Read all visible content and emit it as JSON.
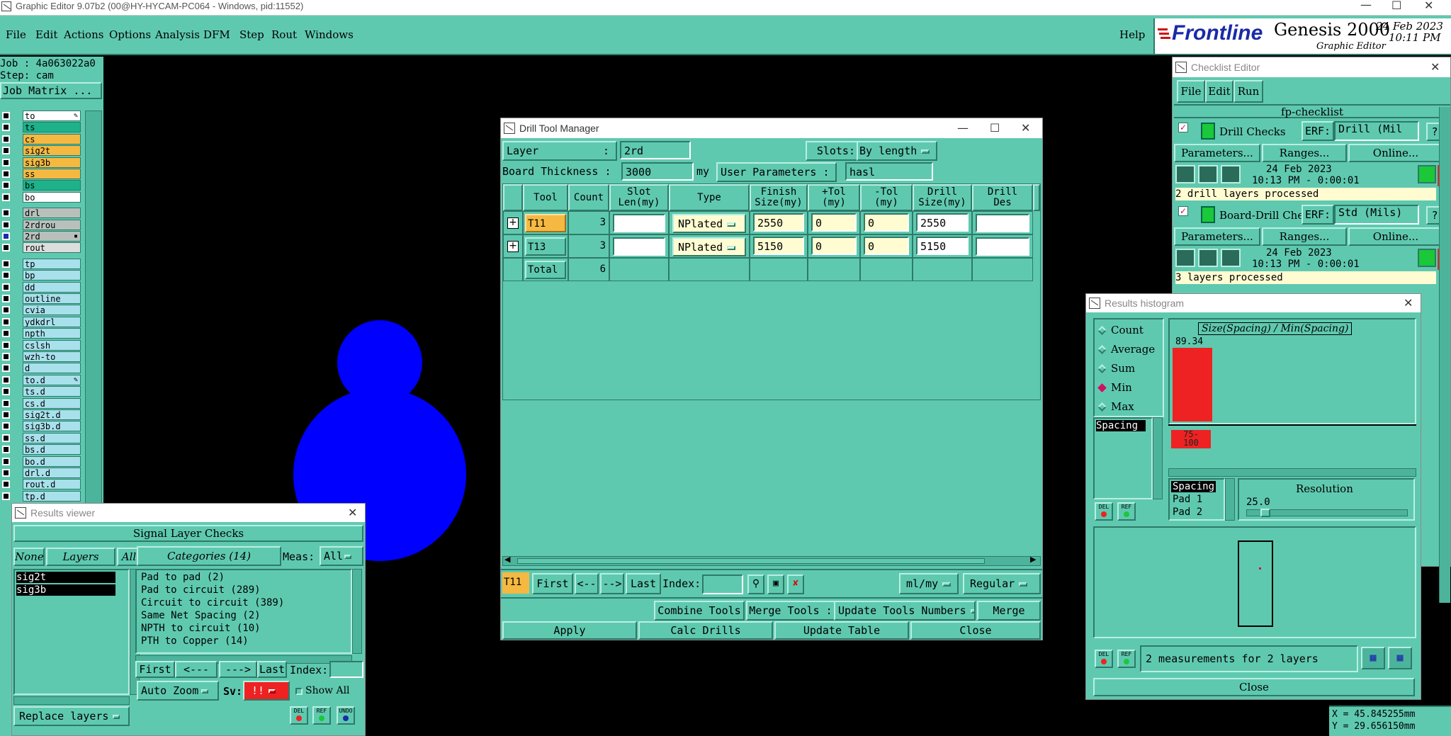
{
  "app": {
    "title_bar": "Graphic Editor 9.07b2 (00@HY-HYCAM-PC064 - Windows, pid:11552)",
    "menu": [
      "File",
      "Edit",
      "Actions",
      "Options",
      "Analysis",
      "DFM",
      "Step",
      "Rout",
      "Windows"
    ],
    "help": "Help",
    "brand": "Frontline",
    "product": "Genesis 2000",
    "subtitle": "Graphic Editor",
    "date": "24 Feb 2023",
    "time": "10:11 PM"
  },
  "left_panel": {
    "job": "Job : 4a063022a0",
    "step": "Step: cam",
    "job_matrix": "Job Matrix ...",
    "layers": [
      {
        "name": "to",
        "bg": "#ffffff",
        "mark": "✎"
      },
      {
        "name": "ts",
        "bg": "#1db28a",
        "mark": ""
      },
      {
        "name": "cs",
        "bg": "#f5b942",
        "mark": ""
      },
      {
        "name": "sig2t",
        "bg": "#f5b942",
        "mark": ""
      },
      {
        "name": "sig3b",
        "bg": "#f5b942",
        "mark": ""
      },
      {
        "name": "ss",
        "bg": "#f5b942",
        "mark": ""
      },
      {
        "name": "bs",
        "bg": "#1db28a",
        "mark": ""
      },
      {
        "name": "bo",
        "bg": "#ffffff",
        "mark": ""
      },
      {
        "name": "drl",
        "bg": "#b8c0bc",
        "mark": ""
      },
      {
        "name": "2rdrou",
        "bg": "#b8c0bc",
        "mark": ""
      },
      {
        "name": "2rd",
        "bg": "#b8c0bc",
        "mark": "▪"
      },
      {
        "name": "rout",
        "bg": "#dddddd",
        "mark": ""
      },
      {
        "name": "tp",
        "bg": "#a8e0ec",
        "mark": ""
      },
      {
        "name": "bp",
        "bg": "#a8e0ec",
        "mark": ""
      },
      {
        "name": "dd",
        "bg": "#a8e0ec",
        "mark": ""
      },
      {
        "name": "outline",
        "bg": "#a8e0ec",
        "mark": ""
      },
      {
        "name": "cvia",
        "bg": "#a8e0ec",
        "mark": ""
      },
      {
        "name": "ydkdrl",
        "bg": "#a8e0ec",
        "mark": ""
      },
      {
        "name": "npth",
        "bg": "#a8e0ec",
        "mark": ""
      },
      {
        "name": "cslsh",
        "bg": "#a8e0ec",
        "mark": ""
      },
      {
        "name": "wzh-to",
        "bg": "#a8e0ec",
        "mark": ""
      },
      {
        "name": "d",
        "bg": "#a8e0ec",
        "mark": ""
      },
      {
        "name": "to.d",
        "bg": "#a8e0ec",
        "mark": "✎"
      },
      {
        "name": "ts.d",
        "bg": "#a8e0ec",
        "mark": ""
      },
      {
        "name": "cs.d",
        "bg": "#a8e0ec",
        "mark": ""
      },
      {
        "name": "sig2t.d",
        "bg": "#a8e0ec",
        "mark": ""
      },
      {
        "name": "sig3b.d",
        "bg": "#a8e0ec",
        "mark": ""
      },
      {
        "name": "ss.d",
        "bg": "#a8e0ec",
        "mark": ""
      },
      {
        "name": "bs.d",
        "bg": "#a8e0ec",
        "mark": ""
      },
      {
        "name": "bo.d",
        "bg": "#a8e0ec",
        "mark": ""
      },
      {
        "name": "drl.d",
        "bg": "#a8e0ec",
        "mark": ""
      },
      {
        "name": "rout.d",
        "bg": "#a8e0ec",
        "mark": ""
      },
      {
        "name": "tp.d",
        "bg": "#a8e0ec",
        "mark": ""
      }
    ]
  },
  "drill_tool_manager": {
    "title": "Drill Tool Manager",
    "layer_label": "Layer",
    "layer_value": "2rd",
    "slots_label": "Slots:",
    "slots_value": "By length",
    "board_thickness_label": "Board Thickness :",
    "board_thickness_value": "3000",
    "board_thickness_unit": "my",
    "user_parameters_label": "User Parameters :",
    "user_parameters_value": "hasl",
    "columns": [
      "Tool",
      "Count",
      "Slot\nLen(my)",
      "Type",
      "Finish\nSize(my)",
      "+Tol\n(my)",
      "-Tol\n(my)",
      "Drill\nSize(my)",
      "Drill\nDes"
    ],
    "rows": [
      {
        "tool": "T11",
        "count": "3",
        "slot_len": "",
        "type": "NPlated",
        "finish": "2550",
        "ptol": "0",
        "mtol": "0",
        "drill": "2550",
        "des": ""
      },
      {
        "tool": "T13",
        "count": "3",
        "slot_len": "",
        "type": "NPlated",
        "finish": "5150",
        "ptol": "0",
        "mtol": "0",
        "drill": "5150",
        "des": ""
      }
    ],
    "total_label": "Total",
    "total_count": "6",
    "current_tool": "T11",
    "first": "First",
    "prev": "<--",
    "next": "-->",
    "last": "Last",
    "index_label": "Index:",
    "units": "ml/my",
    "mode": "Regular",
    "combine_tools": "Combine Tools",
    "merge_tools": "Merge Tools :",
    "update_tools_numbers": "Update Tools Numbers",
    "merge": "Merge",
    "apply": "Apply",
    "calc_drills": "Calc Drills",
    "update_table": "Update Table",
    "close": "Close"
  },
  "checklist_editor": {
    "title": "Checklist Editor",
    "menu": [
      "File",
      "Edit",
      "Run"
    ],
    "checklist_name": "fp-checklist",
    "items": [
      {
        "name": "Drill Checks",
        "erf_label": "ERF:",
        "erf_value": "Drill (Mil",
        "params": "Parameters...",
        "ranges": "Ranges...",
        "online": "Online...",
        "date": "24 Feb 2023",
        "time": "10:13 PM - 0:00:01",
        "status": "2 drill layers processed"
      },
      {
        "name": "Board-Drill Che",
        "erf_label": "ERF:",
        "erf_value": "Std (Mils)",
        "params": "Parameters...",
        "ranges": "Ranges...",
        "online": "Online...",
        "date": "24 Feb 2023",
        "time": "10:13 PM - 0:00:01",
        "status": "3 layers processed"
      }
    ]
  },
  "results_histogram": {
    "title": "Results histogram",
    "stats": [
      "Count",
      "Average",
      "Sum",
      "Min",
      "Max"
    ],
    "selected_stat": "Min",
    "list_item": "Spacing",
    "chart_title": "Size(Spacing) / Min(Spacing)",
    "bar_value": "89.34",
    "bar_bin": "75-\n100",
    "bar_color": "#ee2222",
    "fields": [
      "Spacing",
      "Pad 1",
      "Pad 2"
    ],
    "resolution_label": "Resolution",
    "resolution_value": "25.0",
    "status": "2 measurements for 2 layers",
    "close": "Close",
    "del": "DEL",
    "ref": "REF"
  },
  "results_viewer": {
    "title": "Results viewer",
    "heading": "Signal Layer Checks",
    "none": "None",
    "layers": "Layers",
    "all": "All",
    "layer_list": [
      "sig2t",
      "sig3b"
    ],
    "categories_label": "Categories (14)",
    "meas_label": "Meas:",
    "meas_value": "All",
    "categories": [
      "Pad to pad (2)",
      "Pad to circuit (289)",
      "Circuit to circuit (389)",
      "Same Net Spacing (2)",
      "NPTH to circuit (10)",
      "PTH to Copper (14)"
    ],
    "first": "First",
    "prev": "<---",
    "next": "--->",
    "last": "Last",
    "index_label": "Index:",
    "auto_zoom": "Auto Zoom",
    "sv_label": "Sv:",
    "sv_value": "!!",
    "show_all": "Show All",
    "replace_layers": "Replace layers",
    "del": "DEL",
    "ref": "REF",
    "undo": "UNDO"
  },
  "coords": {
    "x": "X = 45.845255mm",
    "y": "Y = 29.656150mm"
  },
  "colors": {
    "panel": "#5fc9b0",
    "canvas": "#000000",
    "shape": "#0000ff",
    "highlight_tool": "#f5b942",
    "field": "#fffcd2"
  }
}
